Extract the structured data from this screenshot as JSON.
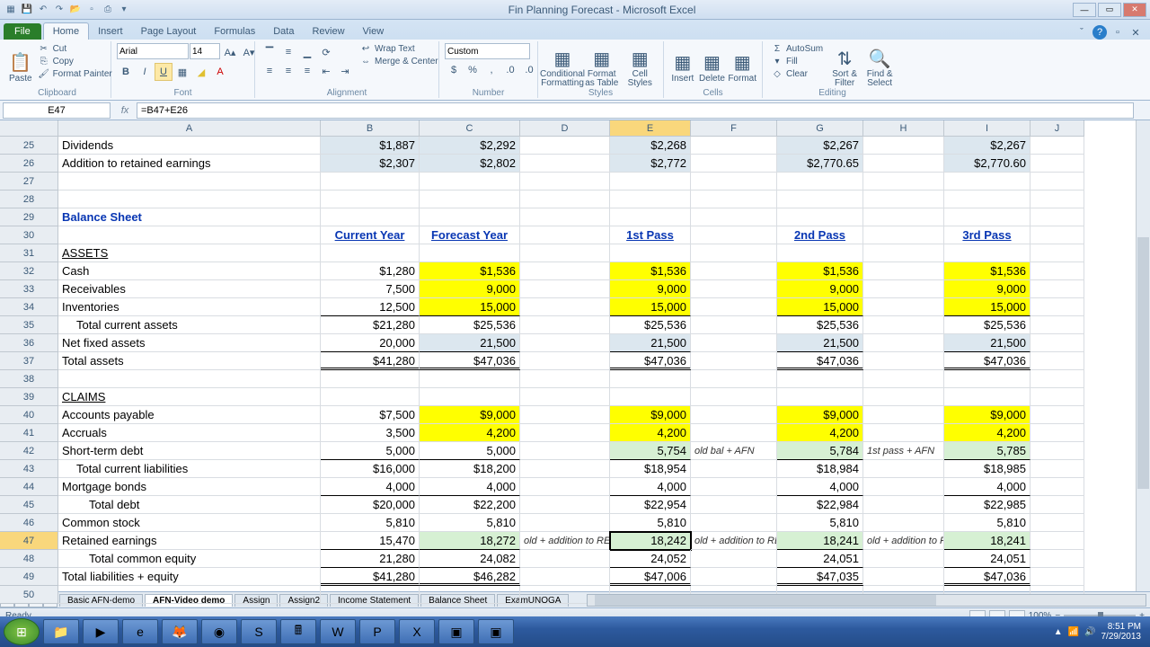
{
  "app": {
    "title": "Fin Planning Forecast - Microsoft Excel"
  },
  "ribbon": {
    "tabs": [
      "File",
      "Home",
      "Insert",
      "Page Layout",
      "Formulas",
      "Data",
      "Review",
      "View"
    ],
    "active_tab": "Home",
    "clipboard": {
      "label": "Clipboard",
      "paste": "Paste",
      "cut": "Cut",
      "copy": "Copy",
      "fp": "Format Painter"
    },
    "font": {
      "label": "Font",
      "name": "Arial",
      "size": "14"
    },
    "align": {
      "label": "Alignment",
      "wrap": "Wrap Text",
      "merge": "Merge & Center"
    },
    "number": {
      "label": "Number",
      "format": "Custom"
    },
    "styles": {
      "label": "Styles",
      "cf": "Conditional\nFormatting",
      "fat": "Format\nas Table",
      "cs": "Cell\nStyles"
    },
    "cells": {
      "label": "Cells",
      "ins": "Insert",
      "del": "Delete",
      "fmt": "Format"
    },
    "editing": {
      "label": "Editing",
      "sum": "AutoSum",
      "fill": "Fill",
      "clear": "Clear",
      "sort": "Sort &\nFilter",
      "find": "Find &\nSelect"
    }
  },
  "fbar": {
    "name": "E47",
    "formula": "=B47+E26"
  },
  "cols": [
    "A",
    "B",
    "C",
    "D",
    "E",
    "F",
    "G",
    "H",
    "I",
    "J"
  ],
  "rows": [
    {
      "n": 25,
      "A": "Dividends",
      "B": "$1,887",
      "C": "$2,292",
      "E": "$2,268",
      "G": "$2,267",
      "I": "$2,267",
      "cls": {
        "B": "r blue",
        "C": "r blue",
        "E": "r blue",
        "G": "r blue",
        "I": "r blue"
      }
    },
    {
      "n": 26,
      "A": "Addition to retained earnings",
      "B": "$2,307",
      "C": "$2,802",
      "E": "$2,772",
      "G": "$2,770.65",
      "I": "$2,770.60",
      "cls": {
        "B": "r blue",
        "C": "r blue",
        "E": "r blue",
        "G": "r blue",
        "I": "r blue"
      }
    },
    {
      "n": 27
    },
    {
      "n": 28
    },
    {
      "n": 29,
      "A": "Balance Sheet",
      "cls": {
        "A": "bold bluetext"
      }
    },
    {
      "n": 30,
      "B": "Current Year",
      "C": "Forecast Year",
      "E": "1st Pass",
      "G": "2nd Pass",
      "I": "3rd Pass",
      "cls": {
        "B": "und bold hdrcell bluetext",
        "C": "und bold hdrcell bluetext",
        "E": "und bold hdrcell bluetext",
        "G": "und bold hdrcell bluetext",
        "I": "und bold hdrcell bluetext"
      }
    },
    {
      "n": 31,
      "A": "ASSETS",
      "cls": {
        "A": "und"
      }
    },
    {
      "n": 32,
      "A": "Cash",
      "B": "$1,280",
      "C": "$1,536",
      "E": "$1,536",
      "G": "$1,536",
      "I": "$1,536",
      "cls": {
        "B": "r",
        "C": "r yellow",
        "E": "r yellow",
        "G": "r yellow",
        "I": "r yellow"
      }
    },
    {
      "n": 33,
      "A": "Receivables",
      "B": "7,500",
      "C": "9,000",
      "E": "9,000",
      "G": "9,000",
      "I": "9,000",
      "cls": {
        "B": "r",
        "C": "r yellow",
        "E": "r yellow",
        "G": "r yellow",
        "I": "r yellow"
      }
    },
    {
      "n": 34,
      "A": "Inventories",
      "B": "12,500",
      "C": "15,000",
      "E": "15,000",
      "G": "15,000",
      "I": "15,000",
      "cls": {
        "B": "r bordbot",
        "C": "r yellow bordbot",
        "E": "r yellow bordbot",
        "G": "r yellow bordbot",
        "I": "r yellow bordbot"
      }
    },
    {
      "n": 35,
      "A": "Total current assets",
      "B": "$21,280",
      "C": "$25,536",
      "E": "$25,536",
      "G": "$25,536",
      "I": "$25,536",
      "cls": {
        "A": "indent1",
        "B": "r",
        "C": "r",
        "E": "r",
        "G": "r",
        "I": "r"
      }
    },
    {
      "n": 36,
      "A": "Net fixed assets",
      "B": "20,000",
      "C": "21,500",
      "E": "21,500",
      "G": "21,500",
      "I": "21,500",
      "cls": {
        "B": "r bordbot",
        "C": "r blue bordbot",
        "E": "r blue bordbot",
        "G": "r blue bordbot",
        "I": "r blue bordbot"
      }
    },
    {
      "n": 37,
      "A": "Total assets",
      "B": "$41,280",
      "C": "$47,036",
      "E": "$47,036",
      "G": "$47,036",
      "I": "$47,036",
      "cls": {
        "B": "r borddbl",
        "C": "r borddbl",
        "E": "r borddbl",
        "G": "r borddbl",
        "I": "r borddbl"
      }
    },
    {
      "n": 38
    },
    {
      "n": 39,
      "A": "CLAIMS",
      "cls": {
        "A": "und"
      }
    },
    {
      "n": 40,
      "A": "Accounts payable",
      "B": "$7,500",
      "C": "$9,000",
      "E": "$9,000",
      "G": "$9,000",
      "I": "$9,000",
      "cls": {
        "B": "r",
        "C": "r yellow",
        "E": "r yellow",
        "G": "r yellow",
        "I": "r yellow"
      }
    },
    {
      "n": 41,
      "A": "Accruals",
      "B": "3,500",
      "C": "4,200",
      "E": "4,200",
      "G": "4,200",
      "I": "4,200",
      "cls": {
        "B": "r",
        "C": "r yellow",
        "E": "r yellow",
        "G": "r yellow",
        "I": "r yellow"
      }
    },
    {
      "n": 42,
      "A": "Short-term debt",
      "B": "5,000",
      "C": "5,000",
      "E": "5,754",
      "F": "old bal + AFN",
      "G": "5,784",
      "H": "1st pass + AFN",
      "I": "5,785",
      "cls": {
        "B": "r bordbot",
        "C": "r bordbot",
        "E": "r lgreen bordbot",
        "F": "note",
        "G": "r lgreen bordbot",
        "H": "note",
        "I": "r lgreen bordbot"
      }
    },
    {
      "n": 43,
      "A": "Total current liabilities",
      "B": "$16,000",
      "C": "$18,200",
      "E": "$18,954",
      "G": "$18,984",
      "I": "$18,985",
      "cls": {
        "A": "indent1",
        "B": "r",
        "C": "r",
        "E": "r",
        "G": "r",
        "I": "r"
      }
    },
    {
      "n": 44,
      "A": "Mortgage bonds",
      "B": "4,000",
      "C": "4,000",
      "E": "4,000",
      "G": "4,000",
      "I": "4,000",
      "cls": {
        "B": "r bordbot",
        "C": "r bordbot",
        "E": "r bordbot",
        "G": "r bordbot",
        "I": "r bordbot"
      }
    },
    {
      "n": 45,
      "A": "Total debt",
      "B": "$20,000",
      "C": "$22,200",
      "E": "$22,954",
      "G": "$22,984",
      "I": "$22,985",
      "cls": {
        "A": "indent2",
        "B": "r",
        "C": "r",
        "E": "r",
        "G": "r",
        "I": "r"
      }
    },
    {
      "n": 46,
      "A": "Common stock",
      "B": "5,810",
      "C": "5,810",
      "E": "5,810",
      "G": "5,810",
      "I": "5,810",
      "cls": {
        "B": "r",
        "C": "r",
        "E": "r",
        "G": "r",
        "I": "r"
      }
    },
    {
      "n": 47,
      "A": "Retained earnings",
      "B": "15,470",
      "C": "18,272",
      "D": "old + addition to RE",
      "E": "18,242",
      "F": "old + addition to RE",
      "G": "18,241",
      "H": "old + addition to RE",
      "I": "18,241",
      "cls": {
        "B": "r bordbot",
        "C": "r lgreen bordbot",
        "D": "note",
        "E": "r lgreen bordbot active",
        "F": "note",
        "G": "r lgreen bordbot",
        "H": "note",
        "I": "r lgreen bordbot"
      },
      "active": true
    },
    {
      "n": 48,
      "A": "Total common equity",
      "B": "21,280",
      "C": "24,082",
      "E": "24,052",
      "G": "24,051",
      "I": "24,051",
      "cls": {
        "A": "indent2",
        "B": "r bordbot",
        "C": "r bordbot",
        "E": "r bordbot",
        "G": "r bordbot",
        "I": "r bordbot"
      }
    },
    {
      "n": 49,
      "A": "Total liabilities + equity",
      "B": "$41,280",
      "C": "$46,282",
      "E": "$47,006",
      "G": "$47,035",
      "I": "$47,036",
      "cls": {
        "B": "r borddbl",
        "C": "r borddbl",
        "E": "r borddbl",
        "G": "r borddbl",
        "I": "r borddbl"
      }
    },
    {
      "n": 50
    }
  ],
  "sheets": {
    "tabs": [
      "Basic AFN-demo",
      "AFN-Video demo",
      "Assign",
      "Assign2",
      "Income Statement",
      "Balance Sheet",
      "ExamUNOGA"
    ],
    "active": "AFN-Video demo"
  },
  "status": {
    "ready": "Ready",
    "zoom": "100%"
  },
  "taskbar": {
    "time": "8:51 PM",
    "date": "7/29/2013"
  }
}
